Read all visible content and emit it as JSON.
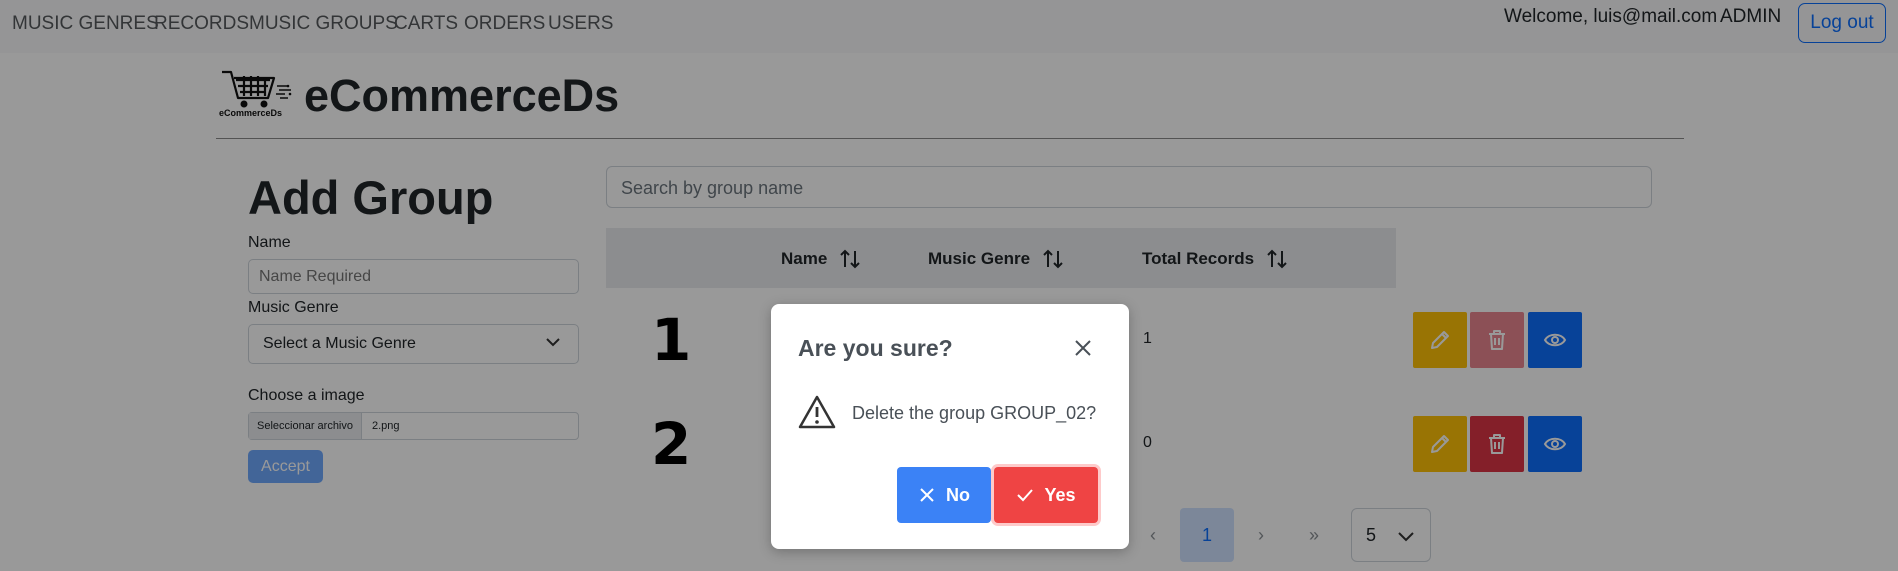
{
  "nav": {
    "links": [
      "MUSIC GENRES",
      "RECORDS",
      "MUSIC GROUPS",
      "CARTS",
      "ORDERS",
      "USERS"
    ],
    "welcome": "Welcome, luis@mail.com",
    "role": "ADMIN",
    "logout": "Log out"
  },
  "brand": {
    "name": "eCommerceDs",
    "logo_caption": "eCommerceDs"
  },
  "form": {
    "title": "Add Group",
    "name_label": "Name",
    "name_placeholder": "Name Required",
    "genre_label": "Music Genre",
    "genre_selected": "Select a Music Genre",
    "image_label": "Choose a image",
    "file_button": "Seleccionar archivo",
    "file_name": "2.png",
    "accept": "Accept"
  },
  "search": {
    "placeholder": "Search by group name"
  },
  "table": {
    "headers": [
      "Name",
      "Music Genre",
      "Total Records"
    ],
    "rows": [
      {
        "num": "1",
        "total": "1",
        "delete_enabled": false
      },
      {
        "num": "2",
        "total": "0",
        "delete_enabled": true
      }
    ]
  },
  "pagination": {
    "first": "«",
    "prev": "‹",
    "current": "1",
    "next": "›",
    "last": "»",
    "page_size": "5"
  },
  "dialog": {
    "title": "Are you sure?",
    "message": "Delete the group GROUP_02?",
    "no": "No",
    "yes": "Yes"
  },
  "colors": {
    "primary": "#0d6efd",
    "warning": "#ffc107",
    "danger": "#dc3545",
    "dialog_no": "#3b82f6",
    "dialog_yes": "#ef4444"
  }
}
